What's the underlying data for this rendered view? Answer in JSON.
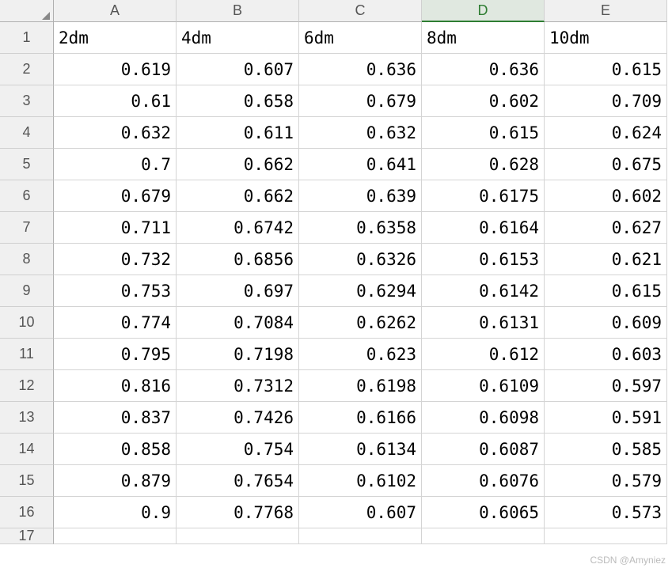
{
  "columns": [
    "A",
    "B",
    "C",
    "D",
    "E"
  ],
  "selectedColumn": "D",
  "rowNumbers": [
    1,
    2,
    3,
    4,
    5,
    6,
    7,
    8,
    9,
    10,
    11,
    12,
    13,
    14,
    15,
    16,
    17
  ],
  "headers": [
    "2dm",
    "4dm",
    "6dm",
    "8dm",
    "10dm"
  ],
  "data": [
    [
      "0.619",
      "0.607",
      "0.636",
      "0.636",
      "0.615"
    ],
    [
      "0.61",
      "0.658",
      "0.679",
      "0.602",
      "0.709"
    ],
    [
      "0.632",
      "0.611",
      "0.632",
      "0.615",
      "0.624"
    ],
    [
      "0.7",
      "0.662",
      "0.641",
      "0.628",
      "0.675"
    ],
    [
      "0.679",
      "0.662",
      "0.639",
      "0.6175",
      "0.602"
    ],
    [
      "0.711",
      "0.6742",
      "0.6358",
      "0.6164",
      "0.627"
    ],
    [
      "0.732",
      "0.6856",
      "0.6326",
      "0.6153",
      "0.621"
    ],
    [
      "0.753",
      "0.697",
      "0.6294",
      "0.6142",
      "0.615"
    ],
    [
      "0.774",
      "0.7084",
      "0.6262",
      "0.6131",
      "0.609"
    ],
    [
      "0.795",
      "0.7198",
      "0.623",
      "0.612",
      "0.603"
    ],
    [
      "0.816",
      "0.7312",
      "0.6198",
      "0.6109",
      "0.597"
    ],
    [
      "0.837",
      "0.7426",
      "0.6166",
      "0.6098",
      "0.591"
    ],
    [
      "0.858",
      "0.754",
      "0.6134",
      "0.6087",
      "0.585"
    ],
    [
      "0.879",
      "0.7654",
      "0.6102",
      "0.6076",
      "0.579"
    ],
    [
      "0.9",
      "0.7768",
      "0.607",
      "0.6065",
      "0.573"
    ]
  ],
  "watermark": "CSDN @Amyniez"
}
